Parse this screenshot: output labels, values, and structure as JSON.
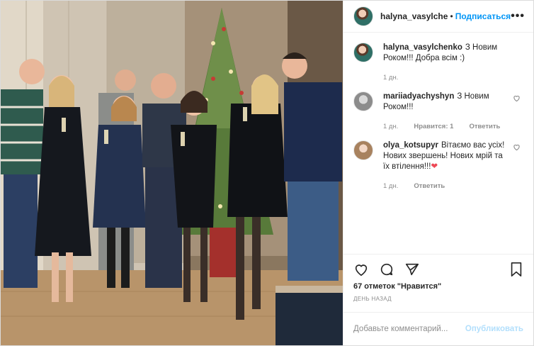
{
  "post": {
    "author": "halyna_vasylchenko",
    "follow_label": "Подписаться",
    "dot": "•",
    "more_icon": "more-icon"
  },
  "comments": [
    {
      "user": "halyna_vasylchenko",
      "text": "З Новим Роком!!! Добра всім :)",
      "time": "1 дн.",
      "likes": "",
      "reply": ""
    },
    {
      "user": "mariiadyachyshyn",
      "text": "З Новим Роком!!!",
      "time": "1 дн.",
      "likes": "Нравится: 1",
      "reply": "Ответить"
    },
    {
      "user": "olya_kotsupyr",
      "text": "Вітаємо вас усіх! Нових звершень! Нових мрій та їх втілення!!!",
      "time": "1 дн.",
      "likes": "",
      "reply": "Ответить"
    }
  ],
  "footer": {
    "likes": "67 отметок \"Нравится\"",
    "ago": "ДЕНЬ НАЗАД",
    "placeholder": "Добавьте комментарий...",
    "publish": "Опубликовать"
  },
  "colors": {
    "accent": "#0095f6",
    "muted": "#8e8e8e",
    "heart": "#ed4956"
  }
}
